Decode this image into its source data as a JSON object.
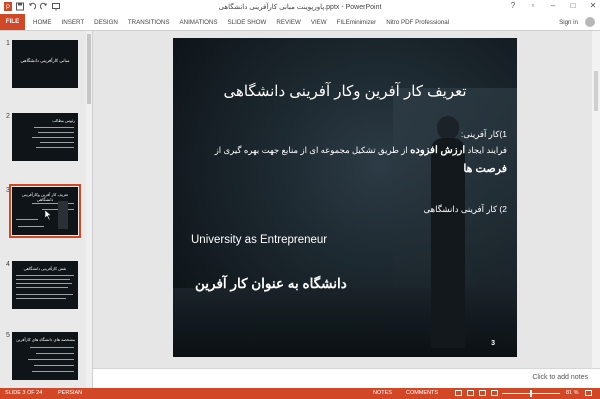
{
  "window": {
    "title": "پاورپوینت مبانی کارآفرینی دانشگاهی.pptx - PowerPoint",
    "signin": "Sign in"
  },
  "ribbon": {
    "tabs": [
      "FILE",
      "HOME",
      "INSERT",
      "DESIGN",
      "TRANSITIONS",
      "ANIMATIONS",
      "SLIDE SHOW",
      "REVIEW",
      "VIEW",
      "FILEminimizer",
      "Nitro PDF Professional"
    ]
  },
  "thumbnails": [
    {
      "number": "1",
      "title": "مبانی کارآفرینی دانشگاهی"
    },
    {
      "number": "2",
      "title": "رئوس مطالب"
    },
    {
      "number": "3",
      "title": "تعریف کار آفرین وکارآفرینی دانشگاهی"
    },
    {
      "number": "4",
      "title": "نقش کارآفرینی دانشگاهی"
    },
    {
      "number": "5",
      "title": "مشخصه های دانشگاه های کارآفرین"
    }
  ],
  "slide": {
    "title": "تعریف کار آفرین وکار آفرینی دانشگاهی",
    "bullet1_heading": "1)کار آفرینی:",
    "bullet1_pre": "فرایند ایجاد",
    "bullet1_bold": "ارزش افزوده",
    "bullet1_post": "از طریق تشکیل مجموعه ای از منابع جهت بهره گیری از",
    "bullet1_tail": "فرصت ها",
    "bullet2": "2) کار آفرینی دانشگاهی",
    "english_line": "University as Entrepreneur",
    "farsi_line": "دانشگاه به عنوان کار آفرین",
    "number": "3"
  },
  "notes": {
    "placeholder": "Click to add notes"
  },
  "status": {
    "slide_indicator": "SLIDE 3 OF 24",
    "language": "PERSIAN",
    "notes_label": "NOTES",
    "comments_label": "COMMENTS",
    "zoom": "81 %"
  }
}
